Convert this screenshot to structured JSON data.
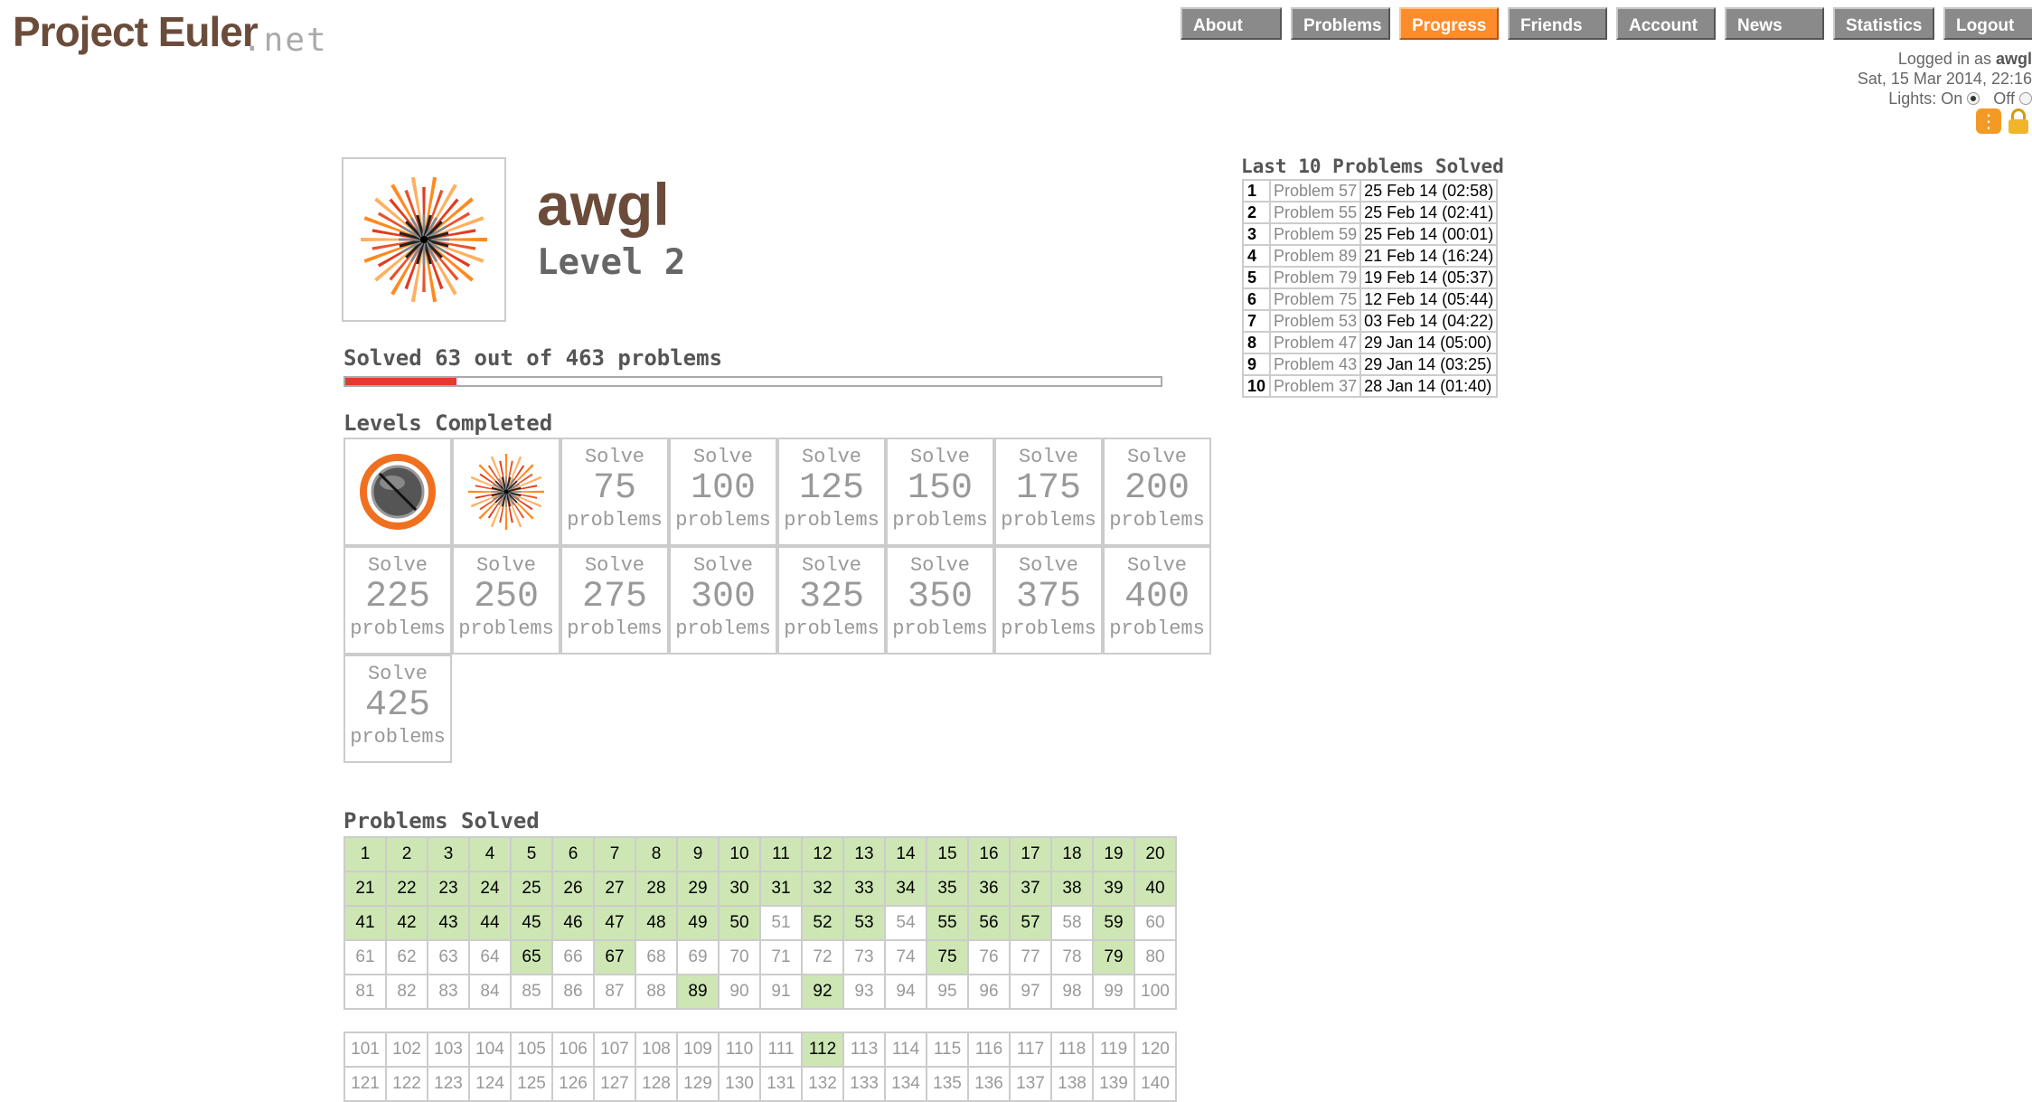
{
  "site": {
    "logo_main": "Project Euler",
    "logo_suffix": ".net"
  },
  "nav": [
    {
      "label": "About",
      "active": false
    },
    {
      "label": "Problems",
      "active": false
    },
    {
      "label": "Progress",
      "active": true
    },
    {
      "label": "Friends",
      "active": false
    },
    {
      "label": "Account",
      "active": false
    },
    {
      "label": "News",
      "active": false
    },
    {
      "label": "Statistics",
      "active": false
    },
    {
      "label": "Logout",
      "active": false
    }
  ],
  "user_info": {
    "logged_in_prefix": "Logged in as",
    "username": "awgl",
    "datetime": "Sat, 15 Mar 2014, 22:16",
    "lights_label": "Lights:",
    "lights_on": "On",
    "lights_off": "Off"
  },
  "profile": {
    "username": "awgl",
    "level": "Level 2",
    "solved_text": "Solved 63 out of 463 problems",
    "solved": 63,
    "total": 463
  },
  "levels_title": "Levels Completed",
  "levels": [
    {
      "completed": true,
      "icon": "level-1-award-icon"
    },
    {
      "completed": true,
      "icon": "level-2-award-icon"
    },
    {
      "completed": false,
      "t1": "Solve",
      "n": "75",
      "t3": "problems"
    },
    {
      "completed": false,
      "t1": "Solve",
      "n": "100",
      "t3": "problems"
    },
    {
      "completed": false,
      "t1": "Solve",
      "n": "125",
      "t3": "problems"
    },
    {
      "completed": false,
      "t1": "Solve",
      "n": "150",
      "t3": "problems"
    },
    {
      "completed": false,
      "t1": "Solve",
      "n": "175",
      "t3": "problems"
    },
    {
      "completed": false,
      "t1": "Solve",
      "n": "200",
      "t3": "problems"
    },
    {
      "completed": false,
      "t1": "Solve",
      "n": "225",
      "t3": "problems"
    },
    {
      "completed": false,
      "t1": "Solve",
      "n": "250",
      "t3": "problems"
    },
    {
      "completed": false,
      "t1": "Solve",
      "n": "275",
      "t3": "problems"
    },
    {
      "completed": false,
      "t1": "Solve",
      "n": "300",
      "t3": "problems"
    },
    {
      "completed": false,
      "t1": "Solve",
      "n": "325",
      "t3": "problems"
    },
    {
      "completed": false,
      "t1": "Solve",
      "n": "350",
      "t3": "problems"
    },
    {
      "completed": false,
      "t1": "Solve",
      "n": "375",
      "t3": "problems"
    },
    {
      "completed": false,
      "t1": "Solve",
      "n": "400",
      "t3": "problems"
    },
    {
      "completed": false,
      "t1": "Solve",
      "n": "425",
      "t3": "problems"
    }
  ],
  "problems_title": "Problems Solved",
  "problems_visible_max": 140,
  "solved_problems": [
    1,
    2,
    3,
    4,
    5,
    6,
    7,
    8,
    9,
    10,
    11,
    12,
    13,
    14,
    15,
    16,
    17,
    18,
    19,
    20,
    21,
    22,
    23,
    24,
    25,
    26,
    27,
    28,
    29,
    30,
    31,
    32,
    33,
    34,
    35,
    36,
    37,
    38,
    39,
    40,
    41,
    42,
    43,
    44,
    45,
    46,
    47,
    48,
    49,
    50,
    52,
    53,
    55,
    56,
    57,
    59,
    65,
    67,
    75,
    79,
    89,
    92,
    112
  ],
  "last10_title": "Last 10 Problems Solved",
  "last10": [
    {
      "n": "1",
      "problem": "Problem 57",
      "date": "25 Feb 14 (02:58)"
    },
    {
      "n": "2",
      "problem": "Problem 55",
      "date": "25 Feb 14 (02:41)"
    },
    {
      "n": "3",
      "problem": "Problem 59",
      "date": "25 Feb 14 (00:01)"
    },
    {
      "n": "4",
      "problem": "Problem 89",
      "date": "21 Feb 14 (16:24)"
    },
    {
      "n": "5",
      "problem": "Problem 79",
      "date": "19 Feb 14 (05:37)"
    },
    {
      "n": "6",
      "problem": "Problem 75",
      "date": "12 Feb 14 (05:44)"
    },
    {
      "n": "7",
      "problem": "Problem 53",
      "date": "03 Feb 14 (04:22)"
    },
    {
      "n": "8",
      "problem": "Problem 47",
      "date": "29 Jan 14 (05:00)"
    },
    {
      "n": "9",
      "problem": "Problem 43",
      "date": "29 Jan 14 (03:25)"
    },
    {
      "n": "10",
      "problem": "Problem 37",
      "date": "28 Jan 14 (01:40)"
    }
  ]
}
